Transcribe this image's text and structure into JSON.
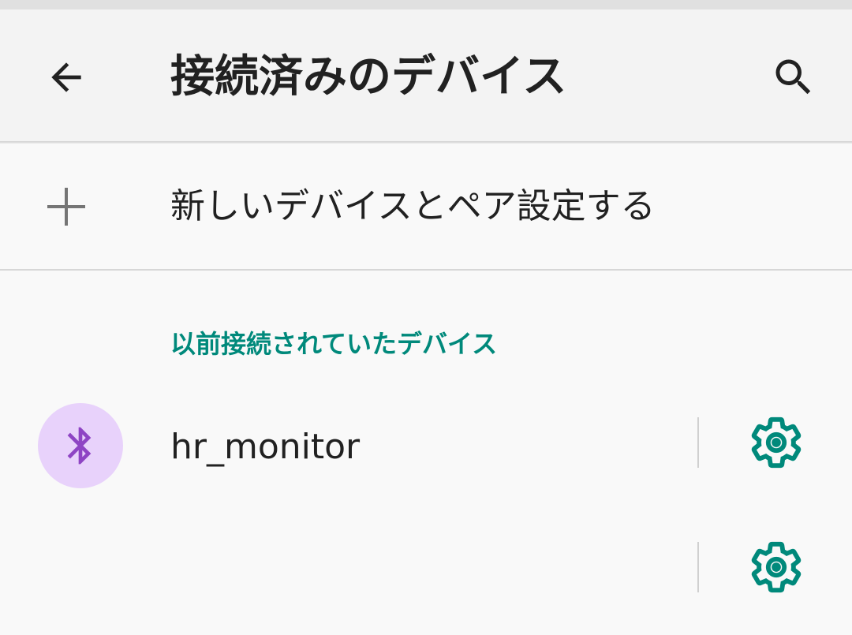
{
  "header": {
    "title": "接続済みのデバイス",
    "back_icon": "arrow-back-icon",
    "search_icon": "search-icon"
  },
  "pair_new": {
    "label": "新しいデバイスとペア設定する",
    "icon": "plus-icon"
  },
  "previous_section": {
    "header": "以前接続されていたデバイス",
    "devices": [
      {
        "name": "hr_monitor",
        "icon": "bluetooth-icon",
        "settings_icon": "gear-icon"
      },
      {
        "name": "",
        "settings_icon": "gear-icon"
      }
    ]
  },
  "colors": {
    "accent": "#00897b",
    "bluetooth_avatar_bg": "#e8d2fb",
    "bluetooth_glyph": "#8e44c4",
    "app_bar_bg": "#f3f3f3",
    "page_bg": "#f9f9f9"
  }
}
